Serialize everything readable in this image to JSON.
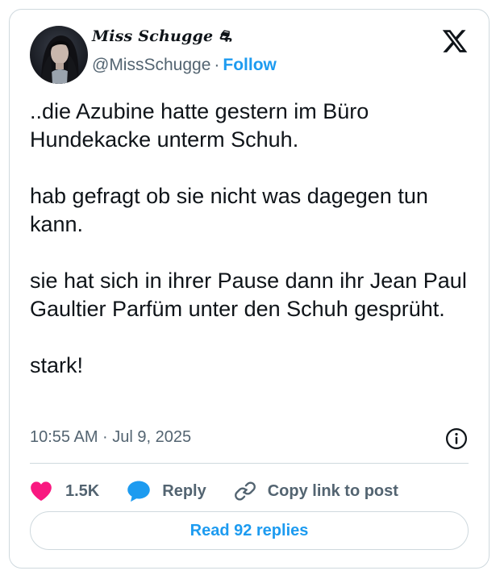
{
  "author": {
    "display_name": "Miss Schugge ⛐",
    "handle": "@MissSchugge",
    "separator": "·",
    "follow_label": "Follow"
  },
  "tweet": {
    "text": "..die Azubine hatte gestern im Büro Hundekacke unterm Schuh.\n\nhab gefragt ob sie nicht was dagegen tun kann.\n\nsie hat sich in ihrer Pause dann ihr Jean Paul Gaultier Parfüm unter den Schuh gesprüht.\n\nstark!",
    "timestamp": "10:55 AM · Jul 9, 2025"
  },
  "actions": {
    "like_count": "1.5K",
    "reply_label": "Reply",
    "copy_link_label": "Copy link to post"
  },
  "footer": {
    "read_replies_label": "Read 92 replies"
  },
  "colors": {
    "accent": "#1d9bf0",
    "like": "#f91880",
    "muted": "#536471",
    "border": "#cfd9de"
  },
  "icons": {
    "platform": "x-logo-icon",
    "info": "info-icon",
    "like": "heart-icon",
    "reply": "speech-bubble-icon",
    "copy": "link-icon"
  }
}
